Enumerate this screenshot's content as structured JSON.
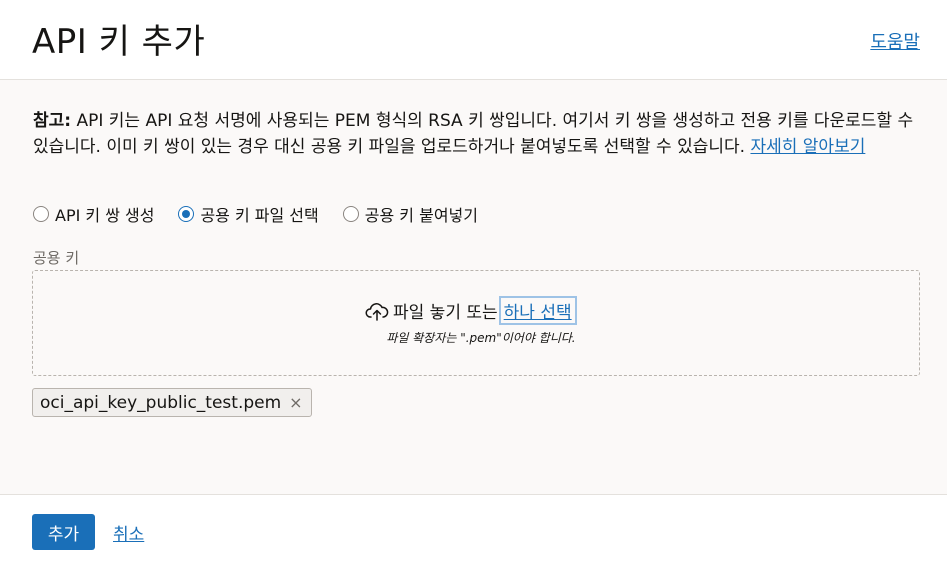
{
  "header": {
    "title": "API 키 추가",
    "help_label": "도움말"
  },
  "note": {
    "label": "참고:",
    "text": " API 키는 API 요청 서명에 사용되는 PEM 형식의 RSA 키 쌍입니다. 여기서 키 쌍을 생성하고 전용 키를 다운로드할 수 있습니다. 이미 키 쌍이 있는 경우 대신 공용 키 파일을 업로드하거나 붙여넣도록 선택할 수 있습니다. ",
    "link": "자세히 알아보기"
  },
  "key_options": [
    {
      "label": "API 키 쌍 생성",
      "selected": false
    },
    {
      "label": "공용 키 파일 선택",
      "selected": true
    },
    {
      "label": "공용 키 붙여넣기",
      "selected": false
    }
  ],
  "public_key": {
    "label": "공용 키",
    "drop_text": "파일 놓기 또는",
    "choose_link": "하나 선택",
    "hint": "파일 확장자는 \".pem\"이어야 합니다.",
    "file_name": "oci_api_key_public_test.pem",
    "remove_icon": "×"
  },
  "footer": {
    "add_label": "추가",
    "cancel_label": "취소"
  },
  "colors": {
    "accent": "#1a6fb8",
    "background": "#fbf9f8"
  }
}
